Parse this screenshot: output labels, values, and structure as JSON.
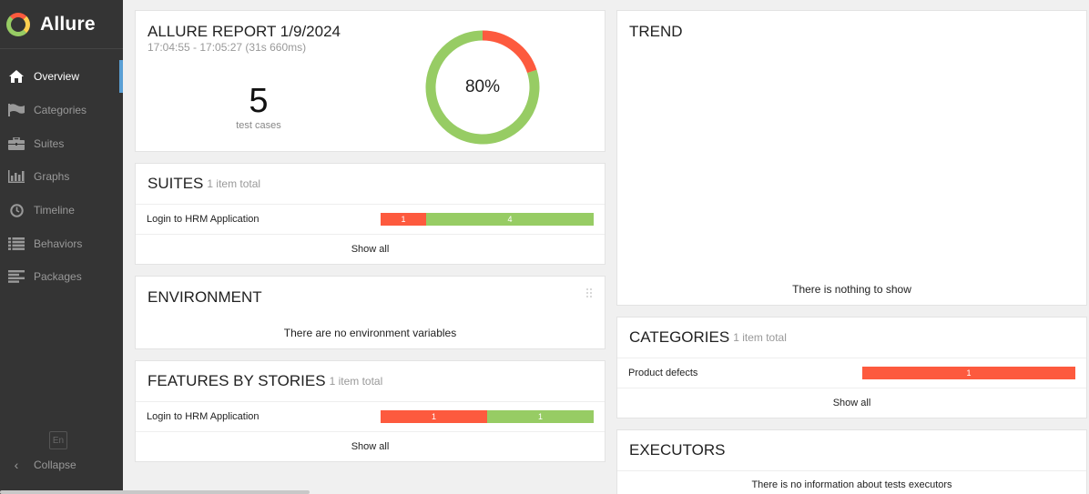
{
  "sidebar": {
    "brand": "Allure",
    "items": [
      {
        "label": "Overview",
        "icon": "home-icon",
        "active": true
      },
      {
        "label": "Categories",
        "icon": "flag-icon"
      },
      {
        "label": "Suites",
        "icon": "briefcase-icon"
      },
      {
        "label": "Graphs",
        "icon": "bar-chart-icon"
      },
      {
        "label": "Timeline",
        "icon": "clock-icon"
      },
      {
        "label": "Behaviors",
        "icon": "list-icon"
      },
      {
        "label": "Packages",
        "icon": "align-left-icon"
      }
    ],
    "language": "En",
    "collapse_label": "Collapse"
  },
  "summary": {
    "title": "ALLURE REPORT 1/9/2024",
    "time_range": "17:04:55 - 17:05:27 (31s 660ms)",
    "test_count": "5",
    "test_count_label": "test cases",
    "success_percent": "80%",
    "success_fraction": 0.8,
    "colors": {
      "passed": "#97cc64",
      "failed": "#fd5a3e"
    }
  },
  "suites": {
    "title": "SUITES",
    "subtitle": "1 item total",
    "rows": [
      {
        "name": "Login to HRM Application",
        "failed": "1",
        "passed": "4"
      }
    ],
    "show_all": "Show all"
  },
  "environment": {
    "title": "ENVIRONMENT",
    "empty_text": "There are no environment variables"
  },
  "features": {
    "title": "FEATURES BY STORIES",
    "subtitle": "1 item total",
    "rows": [
      {
        "name": "Login to HRM Application",
        "failed": "1",
        "passed": "1"
      }
    ],
    "show_all": "Show all"
  },
  "trend": {
    "title": "TREND",
    "empty_text": "There is nothing to show"
  },
  "categories": {
    "title": "CATEGORIES",
    "subtitle": "1 item total",
    "rows": [
      {
        "name": "Product defects",
        "failed": "1"
      }
    ],
    "show_all": "Show all"
  },
  "executors": {
    "title": "EXECUTORS",
    "empty_text": "There is no information about tests executors"
  }
}
